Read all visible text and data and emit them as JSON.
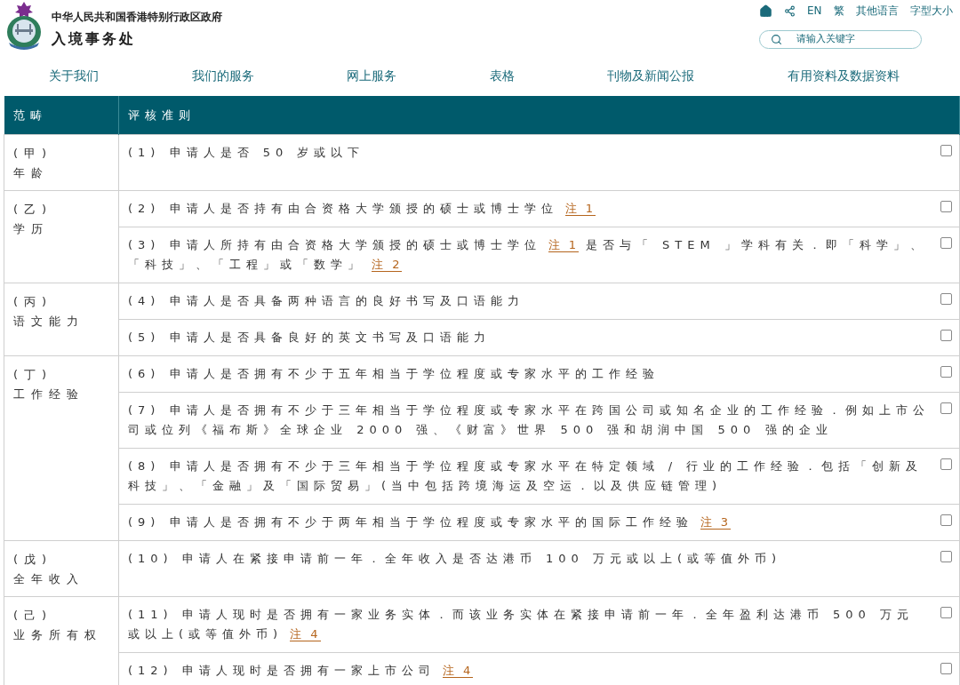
{
  "header": {
    "government": "中华人民共和国香港特别行政区政府",
    "department": "入境事务处"
  },
  "top_links": [
    {
      "kind": "home"
    },
    {
      "kind": "share"
    },
    {
      "kind": "text",
      "text": "EN"
    },
    {
      "kind": "text",
      "text": "繁"
    },
    {
      "kind": "text",
      "text": "其他语言"
    },
    {
      "kind": "text",
      "text": "字型大小"
    }
  ],
  "search": {
    "placeholder": "请输入关键字"
  },
  "nav": [
    "关于我们",
    "我们的服务",
    "网上服务",
    "表格",
    "刊物及新闻公报",
    "有用资料及数据资料"
  ],
  "table": {
    "columns": [
      "范畴",
      "评核准则"
    ],
    "categories": [
      {
        "label": "(甲)",
        "name": "年龄",
        "criteria": [
          {
            "parts": [
              {
                "kind": "text",
                "text": "(1) 申请人是否 50 岁或以下"
              }
            ],
            "checked": false
          }
        ]
      },
      {
        "label": "(乙)",
        "name": "学历",
        "criteria": [
          {
            "parts": [
              {
                "kind": "text",
                "text": "(2) 申请人是否持有由合资格大学颁授的硕士或博士学位"
              },
              {
                "kind": "note",
                "text": "注 1"
              }
            ],
            "checked": false
          },
          {
            "parts": [
              {
                "kind": "text",
                "text": "(3) 申请人所持有由合资格大学颁授的硕士或博士学位"
              },
              {
                "kind": "note",
                "text": "注 1"
              },
              {
                "kind": "text",
                "text": "是否与「 STEM 」学科有关．即「科学」、「科技」、「工程」或「数学」"
              },
              {
                "kind": "note",
                "text": "注 2"
              }
            ],
            "checked": false
          }
        ]
      },
      {
        "label": "(丙)",
        "name": "语文能力",
        "criteria": [
          {
            "parts": [
              {
                "kind": "text",
                "text": "(4) 申请人是否具备两种语言的良好书写及口语能力"
              }
            ],
            "checked": false
          },
          {
            "parts": [
              {
                "kind": "text",
                "text": "(5) 申请人是否具备良好的英文书写及口语能力"
              }
            ],
            "checked": false
          }
        ]
      },
      {
        "label": "(丁)",
        "name": "工作经验",
        "criteria": [
          {
            "parts": [
              {
                "kind": "text",
                "text": "(6) 申请人是否拥有不少于五年相当于学位程度或专家水平的工作经验"
              }
            ],
            "checked": false
          },
          {
            "parts": [
              {
                "kind": "text",
                "text": "(7) 申请人是否拥有不少于三年相当于学位程度或专家水平在跨国公司或知名企业的工作经验．例如上市公司或位列《福布斯》全球企业 2000 强、《财富》世界 500 强和胡润中国 500 强的企业"
              }
            ],
            "checked": false
          },
          {
            "parts": [
              {
                "kind": "text",
                "text": "(8) 申请人是否拥有不少于三年相当于学位程度或专家水平在特定领域 / 行业的工作经验．包括「创新及科技」、「金融」及「国际贸易」(当中包括跨境海运及空运．以及供应链管理)"
              }
            ],
            "checked": false
          },
          {
            "parts": [
              {
                "kind": "text",
                "text": "(9) 申请人是否拥有不少于两年相当于学位程度或专家水平的国际工作经验"
              },
              {
                "kind": "note",
                "text": "注 3"
              }
            ],
            "checked": false
          }
        ]
      },
      {
        "label": "(戊)",
        "name": "全年收入",
        "criteria": [
          {
            "parts": [
              {
                "kind": "text",
                "text": "(10) 申请人在紧接申请前一年．全年收入是否达港币 100 万元或以上(或等值外币)"
              }
            ],
            "checked": false
          }
        ]
      },
      {
        "label": "(己)",
        "name": "业务所有权",
        "criteria": [
          {
            "parts": [
              {
                "kind": "text",
                "text": "(11) 申请人现时是否拥有一家业务实体．而该业务实体在紧接申请前一年．全年盈利达港币 500 万元或以上(或等值外币)"
              },
              {
                "kind": "note",
                "text": "注 4"
              }
            ],
            "checked": false
          },
          {
            "parts": [
              {
                "kind": "text",
                "text": "(12) 申请人现时是否拥有一家上市公司"
              },
              {
                "kind": "note",
                "text": "注 4"
              }
            ],
            "checked": false
          }
        ]
      }
    ]
  }
}
